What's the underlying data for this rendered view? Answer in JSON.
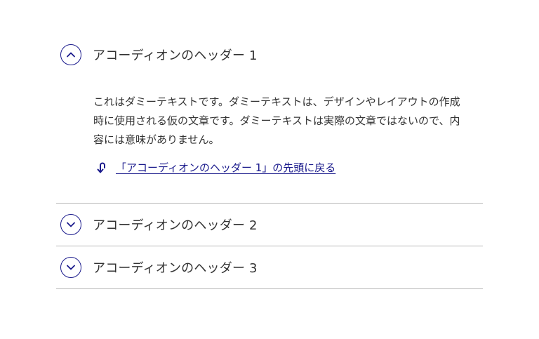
{
  "accordion": {
    "items": [
      {
        "title": "アコーディオンのヘッダー 1",
        "expanded": true,
        "body": "これはダミーテキストです。ダミーテキストは、デザインやレイアウトの作成時に使用される仮の文章です。ダミーテキストは実際の文章ではないので、内容には意味がありません。",
        "back_link": "「アコーディオンのヘッダー 1」の先頭に戻る"
      },
      {
        "title": "アコーディオンのヘッダー 2",
        "expanded": false
      },
      {
        "title": "アコーディオンのヘッダー 3",
        "expanded": false
      }
    ]
  },
  "colors": {
    "accent": "#1a1a8c",
    "text": "#333333",
    "divider": "#b8b8b8"
  },
  "icons": {
    "open": "chevron-up-icon",
    "closed": "chevron-down-icon",
    "back": "return-arrow-icon"
  }
}
